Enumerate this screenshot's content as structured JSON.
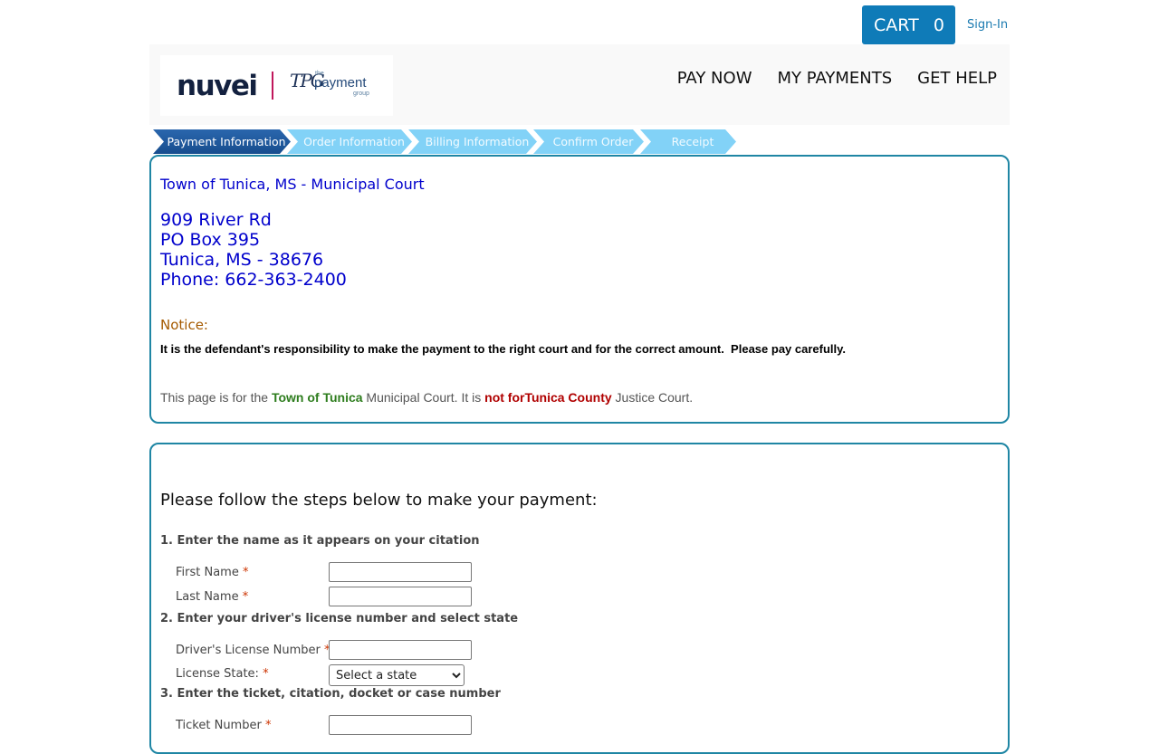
{
  "topbar": {
    "cart_label": "CART",
    "cart_count": "0",
    "signin_label": "Sign-In"
  },
  "header": {
    "logo": {
      "nuvei": "nuvei",
      "tpg_mark": "TPG",
      "tpg_the": "the",
      "tpg_payment": "payment",
      "tpg_group": "group"
    },
    "nav": [
      "PAY NOW",
      "MY PAYMENTS",
      "GET HELP"
    ]
  },
  "steps": [
    "Payment Information",
    "Order Information",
    "Billing Information",
    "Confirm Order",
    "Receipt"
  ],
  "court": {
    "name": "Town of Tunica, MS - Municipal Court",
    "address_line1": "909 River Rd",
    "address_line2": "PO Box 395",
    "address_line3": "Tunica, MS - 38676",
    "phone": "Phone: 662-363-2400"
  },
  "notice": {
    "label": "Notice:",
    "text": "It is the defendant's responsibility to make the payment to the right court and for the correct amount.  Please pay carefully."
  },
  "disclaimer": {
    "part1": "This page is for the ",
    "highlight1": "Town of Tunica",
    "part2": " Municipal Court. It is ",
    "highlight2": "not forTunica County",
    "part3": " Justice Court."
  },
  "form": {
    "title": "Please follow the steps below to make your payment:",
    "section1": "1. Enter the name as it appears on your citation",
    "first_name_label": "First Name",
    "last_name_label": "Last Name",
    "section2": "2. Enter your driver's license number and select state",
    "license_label": "Driver's License Number",
    "state_label": "License State:",
    "state_selected": "Select a state",
    "section3": "3. Enter the ticket, citation, docket or case number",
    "ticket_label": "Ticket Number",
    "required_mark": "*"
  },
  "colors": {
    "primary": "#0f7bb8",
    "panel_border": "#1f86a4",
    "court_text": "#0000cc",
    "step_active": "#174d8e",
    "step_inactive": "#82d2f7"
  }
}
